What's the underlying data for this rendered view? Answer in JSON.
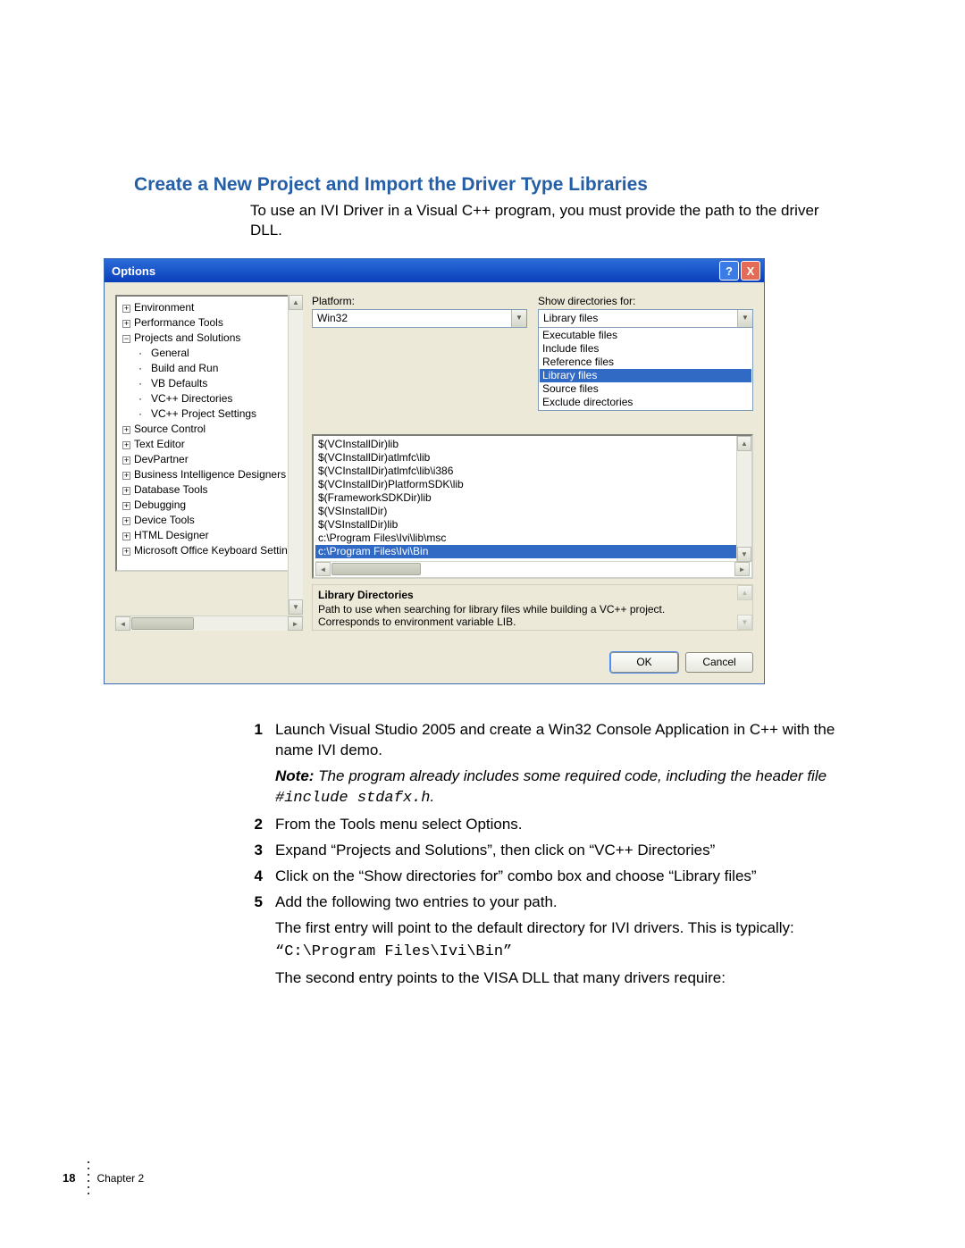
{
  "section_title": "Create a New Project and Import the Driver Type Libraries",
  "intro": "To use an IVI Driver in a Visual C++ program, you must provide the path to the driver DLL.",
  "dialog": {
    "title": "Options",
    "help_btn": "?",
    "close_btn": "X",
    "tree": {
      "items": [
        {
          "sym": "+",
          "label": "Environment"
        },
        {
          "sym": "+",
          "label": "Performance Tools"
        },
        {
          "sym": "−",
          "label": "Projects and Solutions",
          "children": [
            "General",
            "Build and Run",
            "VB Defaults",
            "VC++ Directories",
            "VC++ Project Settings"
          ]
        },
        {
          "sym": "+",
          "label": "Source Control"
        },
        {
          "sym": "+",
          "label": "Text Editor"
        },
        {
          "sym": "+",
          "label": "DevPartner"
        },
        {
          "sym": "+",
          "label": "Business Intelligence Designers"
        },
        {
          "sym": "+",
          "label": "Database Tools"
        },
        {
          "sym": "+",
          "label": "Debugging"
        },
        {
          "sym": "+",
          "label": "Device Tools"
        },
        {
          "sym": "+",
          "label": "HTML Designer"
        },
        {
          "sym": "+",
          "label": "Microsoft Office Keyboard Setting"
        }
      ],
      "selected_child": "VC++ Directories"
    },
    "platform_label": "Platform:",
    "platform_value": "Win32",
    "showdir_label": "Show directories for:",
    "showdir_value": "Library files",
    "dropdown_options": [
      "Executable files",
      "Include files",
      "Reference files",
      "Library files",
      "Source files",
      "Exclude directories"
    ],
    "dropdown_selected": "Library files",
    "paths": [
      "$(VCInstallDir)lib",
      "$(VCInstallDir)atlmfc\\lib",
      "$(VCInstallDir)atlmfc\\lib\\i386",
      "$(VCInstallDir)PlatformSDK\\lib",
      "$(FrameworkSDKDir)lib",
      "$(VSInstallDir)",
      "$(VSInstallDir)lib",
      "c:\\Program Files\\Ivi\\lib\\msc",
      "c:\\Program Files\\Ivi\\Bin"
    ],
    "path_selected_index": 8,
    "help_title": "Library Directories",
    "help_text": "Path to use when searching for library files while building a VC++ project. Corresponds to environment variable LIB.",
    "ok_label": "OK",
    "cancel_label": "Cancel"
  },
  "steps": [
    {
      "n": "1",
      "text": "Launch Visual Studio 2005 and create a Win32 Console Application in C++ with the name IVI demo."
    },
    {
      "n": "2",
      "text": "From the Tools menu select Options."
    },
    {
      "n": "3",
      "text": "Expand “Projects and Solutions”, then click on “VC++ Directories”"
    },
    {
      "n": "4",
      "text": "Click on the “Show directories for” combo box and choose “Library files”"
    },
    {
      "n": "5",
      "text": "Add the following two entries to your path."
    }
  ],
  "note_label": "Note:",
  "note_text": " The program already includes some required code, including the header file ",
  "note_code": "#include stdafx.h",
  "after1": "The first entry will point to the default directory for IVI drivers. This is typically:",
  "after_code": "“C:\\Program Files\\Ivi\\Bin”",
  "after2": "The second entry points to the VISA DLL that many drivers require:",
  "footer": {
    "page": "18",
    "chapter": "Chapter 2"
  }
}
